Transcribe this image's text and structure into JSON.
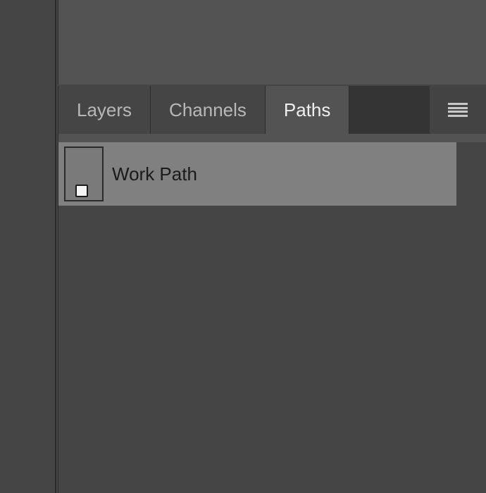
{
  "tabs": [
    {
      "label": "Layers",
      "active": false
    },
    {
      "label": "Channels",
      "active": false
    },
    {
      "label": "Paths",
      "active": true
    }
  ],
  "paths": {
    "items": [
      {
        "label": "Work Path"
      }
    ]
  }
}
